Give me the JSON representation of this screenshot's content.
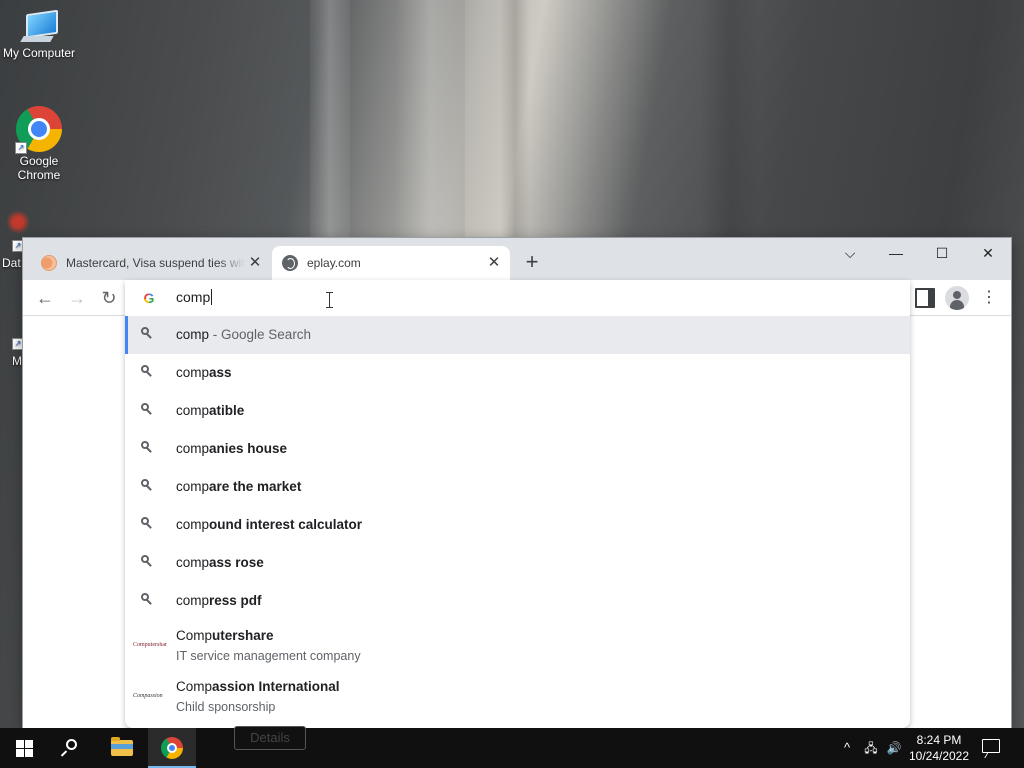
{
  "desktop": {
    "icons": [
      {
        "label": "My Computer"
      },
      {
        "label": "Google Chrome"
      },
      {
        "label": "Dat"
      },
      {
        "label": "M"
      }
    ]
  },
  "browser": {
    "tabs": [
      {
        "title": "Mastercard, Visa suspend ties with",
        "favicon": "mastercard-favicon",
        "active": false
      },
      {
        "title": "eplay.com",
        "favicon": "globe-icon",
        "active": true
      }
    ],
    "window_controls": {
      "dropdown": "⌵",
      "minimize": "—",
      "maximize": "☐",
      "close": "✕"
    },
    "nav": {
      "back": "←",
      "forward": "→",
      "reload": "↻"
    },
    "omnibox": {
      "value": "comp",
      "suggestions": [
        {
          "typed": "comp",
          "rest": "",
          "hint": " - Google Search",
          "selected": true
        },
        {
          "typed": "comp",
          "rest": "ass"
        },
        {
          "typed": "comp",
          "rest": "atible"
        },
        {
          "typed": "comp",
          "rest": "anies house"
        },
        {
          "typed": "comp",
          "rest": "are the market"
        },
        {
          "typed": "comp",
          "rest": "ound interest calculator"
        },
        {
          "typed": "comp",
          "rest": "ass rose"
        },
        {
          "typed": "comp",
          "rest": "ress pdf"
        }
      ],
      "entities": [
        {
          "typed": "Comp",
          "rest": "utershare",
          "subtitle": "IT service management company",
          "logo_text": "Computershare"
        },
        {
          "typed": "Comp",
          "rest": "assion International",
          "subtitle": "Child sponsorship",
          "logo_text": "Compassion"
        }
      ]
    },
    "page_button": "Details"
  },
  "taskbar": {
    "time": "8:24 PM",
    "date": "10/24/2022",
    "tray": {
      "chevron": "^",
      "network": "🖧",
      "volume": "🔊"
    }
  },
  "colors": {
    "accent": "#4285f4",
    "tabbar": "#dee1e6",
    "taskbar": "#101010"
  }
}
